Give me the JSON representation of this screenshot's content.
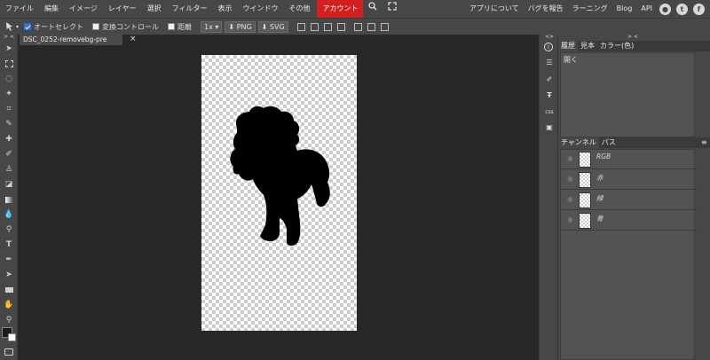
{
  "menu": {
    "items": [
      "ファイル",
      "編集",
      "イメージ",
      "レイヤー",
      "選択",
      "フィルター",
      "表示",
      "ウインドウ",
      "その他",
      "アカウント"
    ],
    "right_items": [
      "アプリについて",
      "バグを報告",
      "ラーニング",
      "Blog",
      "API"
    ],
    "social_icons": [
      "reddit-icon",
      "twitter-icon",
      "facebook-icon"
    ]
  },
  "options": {
    "auto_select": "オートセレクト",
    "transform_controls": "変換コントロール",
    "distances": "距離",
    "zoom": "1x",
    "png_label": "PNG",
    "svg_label": "SVG"
  },
  "tab": {
    "title": "DSC_0252-removebg-pre",
    "close": "×"
  },
  "panels": {
    "top_tabs": [
      "履歴",
      "見本",
      "カラー(色)"
    ],
    "history_item": "開く",
    "bottom_tabs": [
      "チャンネル",
      "パス"
    ],
    "channels": [
      "RGB",
      "赤",
      "緑",
      "青"
    ],
    "collapse_left": "> <",
    "collapse_right": "> <",
    "strip_toggle": "<>"
  },
  "colors": {
    "accent": "#d02020",
    "foreground": "#1a1a1a",
    "background": "#ffffff"
  }
}
